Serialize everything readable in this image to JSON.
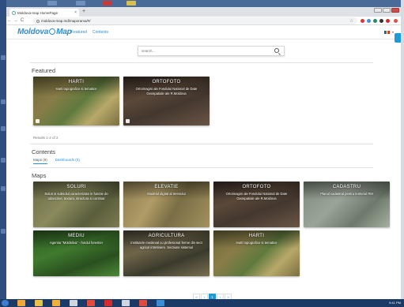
{
  "browser": {
    "tab_title": "Moldova-map HomePage",
    "new_tab": "+",
    "back": "←",
    "forward": "→",
    "reload": "C",
    "url": "moldova-map.md/maporama/#/",
    "star": "☆"
  },
  "site": {
    "logo_left": "Moldova",
    "logo_right": "Map",
    "nav": [
      "Featured",
      "Contents"
    ]
  },
  "search": {
    "placeholder": "search..."
  },
  "featured": {
    "title": "Featured",
    "cards": [
      {
        "title": "HARTI",
        "desc": "Harti topografice si tematice"
      },
      {
        "title": "ORTOFOTO",
        "desc": "Ortoimagini ale Fondului National de Date Geospatiale ale R.Moldova"
      }
    ],
    "results": "Results 1-2 of 2"
  },
  "contents": {
    "title": "Contents",
    "tabs": [
      "Maps (9)",
      "Dashboards (0)"
    ]
  },
  "maps": {
    "title": "Maps",
    "cards": [
      {
        "title": "SOLURI",
        "desc": "Soluri si subsolul caracterizate in functie de adancime, textura, structura si continut"
      },
      {
        "title": "ELEVATIE",
        "desc": "Modelul digital al terenului"
      },
      {
        "title": "ORTOFOTO",
        "desc": "Ortoimagini ale Fondului National de Date Geospatiale ale R.Moldova"
      },
      {
        "title": "CADASTRU",
        "desc": "Planul cadastral pentru teritoriul RM"
      },
      {
        "title": "MEDIU",
        "desc": "Agentia \"Moldsilva\" - fondul forestier"
      },
      {
        "title": "AGRICULTURA",
        "desc": "Institutele medieval cu profesional ferme din sect agricol intretinere. Sectiune sistemul"
      },
      {
        "title": "HARTI",
        "desc": "Harti topografice si tematice"
      }
    ]
  },
  "pagination": {
    "prev": "«",
    "page": "1",
    "next": "»",
    "first": "‹",
    "last": "›"
  },
  "taskbar": {
    "clock": "9:41 PM"
  }
}
